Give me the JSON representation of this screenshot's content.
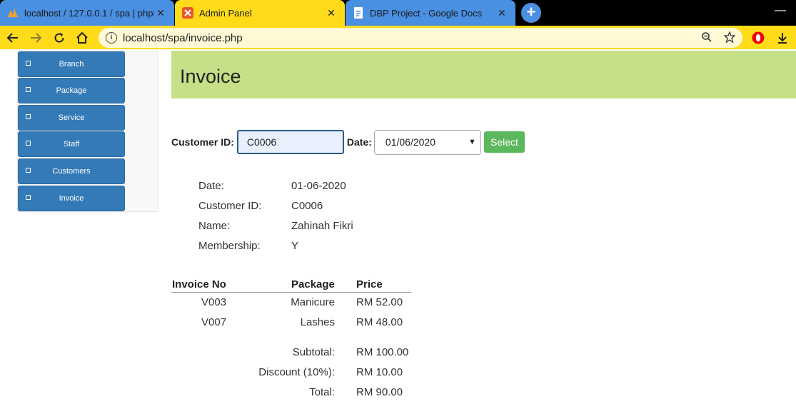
{
  "browser": {
    "tabs": [
      {
        "title": "localhost / 127.0.0.1 / spa | phpM"
      },
      {
        "title": "Admin Panel"
      },
      {
        "title": "DBP Project - Google Docs"
      }
    ],
    "url": "localhost/spa/invoice.php"
  },
  "sidebar": {
    "items": [
      {
        "label": "Branch"
      },
      {
        "label": "Package"
      },
      {
        "label": "Service"
      },
      {
        "label": "Staff"
      },
      {
        "label": "Customers"
      },
      {
        "label": "Invoice"
      }
    ]
  },
  "page": {
    "title": "Invoice"
  },
  "form": {
    "customer_id_label": "Customer ID:",
    "customer_id_value": "C0006",
    "date_label": "Date:",
    "date_value": "01/06/2020",
    "select_label": "Select"
  },
  "info": {
    "date_label": "Date:",
    "date_value": "01-06-2020",
    "cust_label": "Customer ID:",
    "cust_value": "C0006",
    "name_label": "Name:",
    "name_value": "Zahinah Fikri",
    "member_label": "Membership:",
    "member_value": "Y"
  },
  "table": {
    "headers": {
      "invoice_no": "Invoice No",
      "package": "Package",
      "price": "Price"
    },
    "rows": [
      {
        "invoice_no": "V003",
        "package": "Manicure",
        "price": "RM 52.00"
      },
      {
        "invoice_no": "V007",
        "package": "Lashes",
        "price": "RM 48.00"
      }
    ],
    "subtotal_label": "Subtotal:",
    "subtotal_value": "RM 100.00",
    "discount_label": "Discount (10%):",
    "discount_value": "RM 10.00",
    "total_label": "Total:",
    "total_value": "RM 90.00"
  },
  "colors": {
    "sidebar_blue": "#337ab7",
    "header_green": "#c5e086",
    "select_green": "#5cb85c",
    "browser_yellow": "#ffdb1a"
  }
}
